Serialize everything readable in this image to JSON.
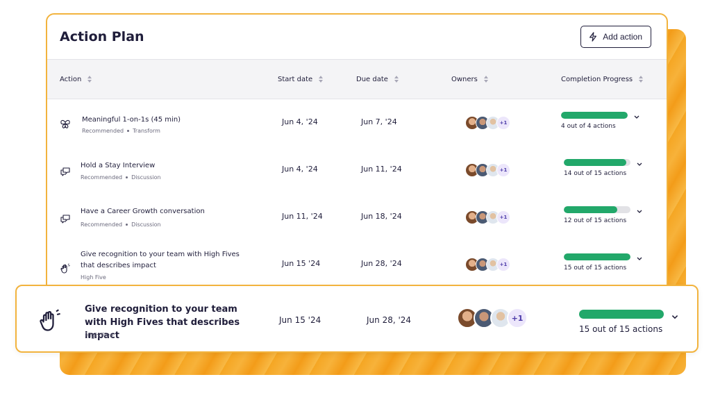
{
  "header": {
    "title": "Action Plan",
    "add_action_label": "Add action"
  },
  "columns": {
    "action": "Action",
    "start_date": "Start date",
    "due_date": "Due date",
    "owners": "Owners",
    "progress": "Completion Progress"
  },
  "rows": [
    {
      "title": "Meaningful 1-on-1s (45 min)",
      "tag1": "Recommended",
      "tag2": "Transform",
      "start": "Jun 4, '24",
      "due": "Jun 7, '24",
      "owners_more": "+1",
      "progress_text": "4 out of 4 actions",
      "progress": 1.0,
      "icon": "butterfly-icon"
    },
    {
      "title": "Hold a Stay Interview",
      "tag1": "Recommended",
      "tag2": "Discussion",
      "start": "Jun 4, '24",
      "due": "Jun 11, '24",
      "owners_more": "+1",
      "progress_text": "14 out of 15 actions",
      "progress": 0.933,
      "icon": "chat-bubbles-icon"
    },
    {
      "title": "Have a Career Growth conversation",
      "tag1": "Recommended",
      "tag2": "Discussion",
      "start": "Jun 11, '24",
      "due": "Jun 18, '24",
      "owners_more": "+1",
      "progress_text": "12 out of 15 actions",
      "progress": 0.8,
      "icon": "chat-bubbles-icon"
    },
    {
      "title": "Give recognition to your team with High Fives that describes impact",
      "tag1": "High Five",
      "start": "Jun 15 '24",
      "due": "Jun 28, '24",
      "owners_more": "+1",
      "progress_text": "15 out of 15 actions",
      "progress": 1.0,
      "icon": "waving-hand-icon"
    }
  ],
  "highlight": {
    "title": "Give recognition to your team with High Fives that describes impact",
    "tag": "High Five",
    "start": "Jun 15 '24",
    "due": "Jun 28, '24",
    "owners_more": "+1",
    "progress_text": "15 out of 15 actions",
    "progress": 1.0,
    "icon": "waving-hand-icon"
  },
  "colors": {
    "accent_orange": "#f5a623",
    "progress_green": "#22a86a",
    "text_dark": "#1f1d3a"
  }
}
